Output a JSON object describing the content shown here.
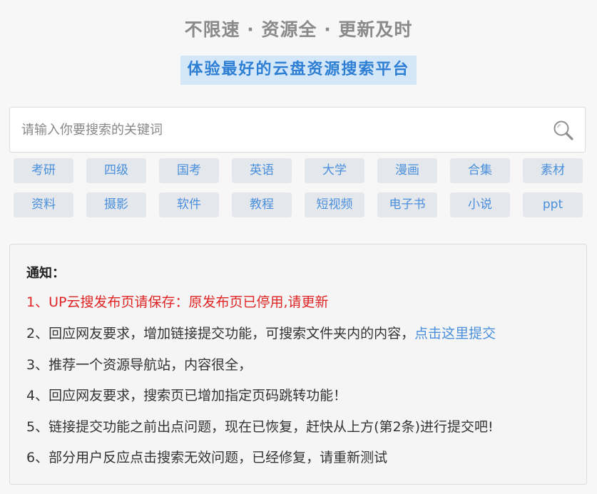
{
  "header": {
    "tagline": "不限速 · 资源全 · 更新及时",
    "slogan": "体验最好的云盘资源搜索平台"
  },
  "search": {
    "placeholder": "请输入你要搜索的关键词",
    "value": "",
    "button_icon": "search-icon"
  },
  "tags": [
    "考研",
    "四级",
    "国考",
    "英语",
    "大学",
    "漫画",
    "合集",
    "素材",
    "资料",
    "摄影",
    "软件",
    "教程",
    "短视频",
    "电子书",
    "小说",
    "ppt"
  ],
  "notice": {
    "title": "通知：",
    "items": [
      {
        "text": "1、UP云搜发布页请保存：原发布页已停用,请更新"
      },
      {
        "text": "2、回应网友要求，增加链接提交功能，可搜索文件夹内的内容，",
        "link": "点击这里提交"
      },
      {
        "text": "3、推荐一个资源导航站，内容很全，"
      },
      {
        "text": "4、回应网友要求，搜索页已增加指定页码跳转功能！"
      },
      {
        "text": "5、链接提交功能之前出点问题，现在已恢复，赶快从上方(第2条)进行提交吧!"
      },
      {
        "text": "6、部分用户反应点击搜索无效问题，已经修复，请重新测试"
      }
    ]
  },
  "colors": {
    "background": "#f7f7f7",
    "tagline": "#8a8a8a",
    "slogan_bg": "#d4e7f9",
    "slogan_text": "#2e7fd4",
    "tag_bg": "#e4e7ec",
    "tag_text": "#4a8fdc",
    "alert_red": "#e02424",
    "link": "#4a8fdc"
  }
}
